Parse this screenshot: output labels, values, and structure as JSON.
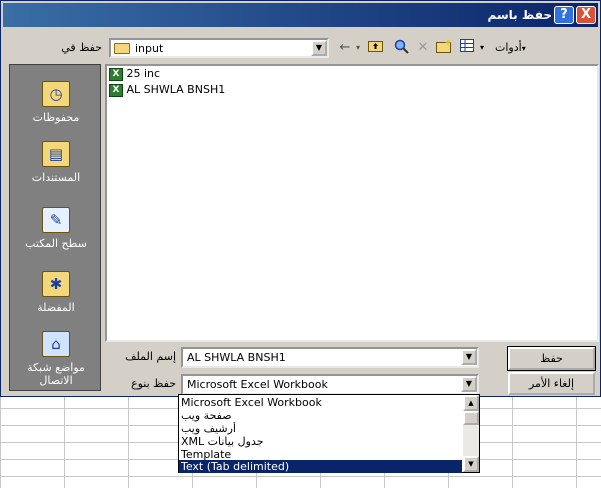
{
  "dialog": {
    "title": "حفظ باسم",
    "help_glyph": "?",
    "close_glyph": "X"
  },
  "toolbar": {
    "lookin_label": "حفظ في",
    "lookin_value": "input",
    "tools_label": "أدوات"
  },
  "places": [
    {
      "icon": "history-icon",
      "label": "محفوظات"
    },
    {
      "icon": "my-documents-icon",
      "label": "المستندات"
    },
    {
      "icon": "desktop-icon",
      "label": "سطح المكتب"
    },
    {
      "icon": "favorites-icon",
      "label": "المفضلة"
    },
    {
      "icon": "network-places-icon",
      "label": "مواضع شبكة الاتصال"
    }
  ],
  "files": [
    {
      "name": "25 inc",
      "icon": "excel-file-icon"
    },
    {
      "name": "AL SHWLA  BNSH1",
      "icon": "excel-file-icon"
    }
  ],
  "filename": {
    "label": "إسم الملف",
    "value": "AL SHWLA  BNSH1"
  },
  "filetype": {
    "label": "حفظ بنوع",
    "value": "Microsoft Excel Workbook",
    "options": [
      "Microsoft Excel Workbook",
      "صفحة ويب",
      "أرشيف ويب",
      "XML جدول بيانات",
      "Template",
      "Text (Tab delimited)"
    ],
    "selected_option": "Text (Tab delimited)"
  },
  "buttons": {
    "save": "حفظ",
    "cancel": "إلغاء الأمر"
  },
  "colors": {
    "titlebar": "#0a246a",
    "selection": "#0a246a",
    "dialog_bg": "#d4d0c8",
    "places_bg": "#808080"
  }
}
